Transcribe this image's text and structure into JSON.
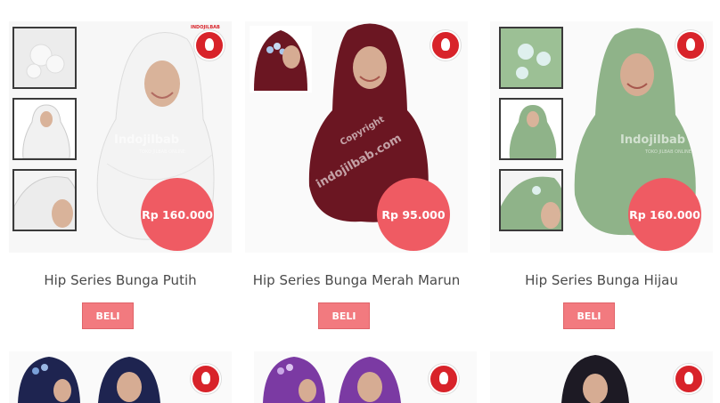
{
  "products": [
    {
      "name": "Hip Series Bunga Putih",
      "price": "Rp 160.000",
      "buy_label": "BELI"
    },
    {
      "name": "Hip Series Bunga Merah Marun",
      "price": "Rp 95.000",
      "buy_label": "BELI"
    },
    {
      "name": "Hip Series Bunga Hijau",
      "price": "Rp 160.000",
      "buy_label": "BELI"
    }
  ],
  "watermark": {
    "brand": "Indojilbab",
    "tagline": "TOKO JILBAB ONLINE",
    "copyright": "Copyright",
    "domain": "indojilbab.com",
    "logo_text": "INDOJILBAB"
  },
  "colors": {
    "white": "#ffffff",
    "maroon": "#6b1622",
    "green": "#8fb389",
    "navy": "#1e2450",
    "purple": "#7b3aa3",
    "price_badge": "#ef5b63",
    "button": "#f27a7f"
  }
}
